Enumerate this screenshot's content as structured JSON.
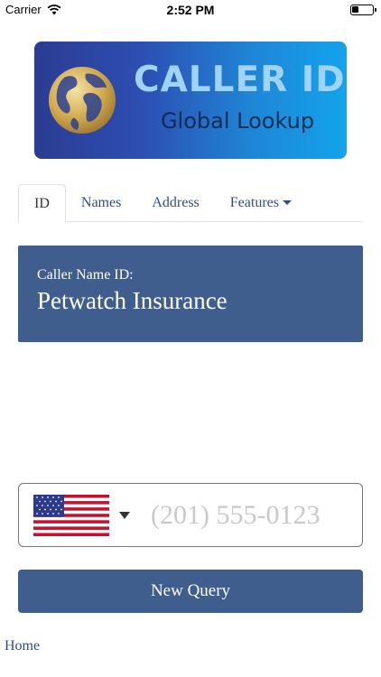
{
  "status_bar": {
    "carrier": "Carrier",
    "time": "2:52 PM",
    "battery_level": 0.35
  },
  "banner": {
    "title": "CALLER ID",
    "subtitle": "Global Lookup",
    "icon": "globe-icon"
  },
  "tabs": [
    {
      "label": "ID",
      "active": true
    },
    {
      "label": "Names",
      "active": false
    },
    {
      "label": "Address",
      "active": false
    },
    {
      "label": "Features",
      "active": false
    }
  ],
  "result": {
    "label": "Caller Name ID:",
    "value": "Petwatch Insurance"
  },
  "phone": {
    "country_icon": "us-flag-icon",
    "placeholder": "(201) 555-0123",
    "value": ""
  },
  "actions": {
    "new_query_label": "New Query"
  },
  "footer": {
    "home_label": "Home"
  },
  "colors": {
    "primary": "#3f5e8e",
    "link": "#2d4f82",
    "banner_start": "#2b3c91",
    "banner_end": "#14a3ec"
  }
}
